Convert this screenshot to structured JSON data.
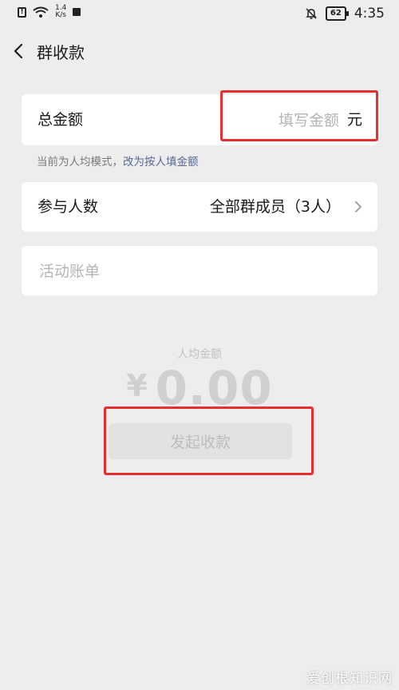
{
  "status_bar": {
    "speed_value": "1.4",
    "speed_unit": "K/s",
    "battery": "62",
    "time": "4:35"
  },
  "header": {
    "title": "群收款"
  },
  "total_card": {
    "label": "总金额",
    "placeholder": "填写金额",
    "unit": "元"
  },
  "mode": {
    "prefix": "当前为人均模式，",
    "link": "改为按人填金额"
  },
  "members_card": {
    "label": "参与人数",
    "value": "全部群成员（3人）"
  },
  "bill_card": {
    "placeholder": "活动账单"
  },
  "per_person": {
    "label": "人均金额",
    "currency": "¥",
    "amount": "0.00"
  },
  "submit": {
    "label": "发起收款"
  },
  "watermark": "爱创根知识网",
  "colors": {
    "background": "#ededed",
    "link": "#576b95",
    "highlight": "#e53030"
  }
}
